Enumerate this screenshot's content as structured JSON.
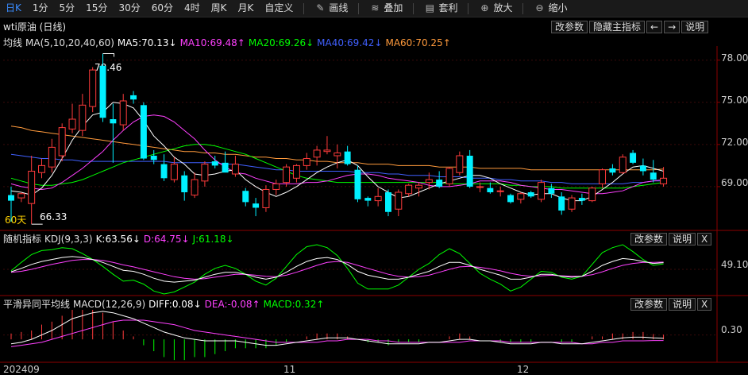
{
  "toolbar": {
    "periods": [
      "日K",
      "1分",
      "5分",
      "15分",
      "30分",
      "60分",
      "4时",
      "周K",
      "月K",
      "自定义"
    ],
    "active_period": "日K",
    "tools": [
      {
        "label": "画线",
        "icon": "pen-icon"
      },
      {
        "label": "叠加",
        "icon": "layers-icon"
      },
      {
        "label": "套利",
        "icon": "arbitrage-icon"
      },
      {
        "label": "放大",
        "icon": "zoom-in-icon"
      },
      {
        "label": "缩小",
        "icon": "zoom-out-icon"
      }
    ]
  },
  "main": {
    "title": "wti原油 (日线)",
    "buttons": [
      "改参数",
      "隐藏主指标",
      "←",
      "→",
      "说明"
    ],
    "ma_legend": {
      "name": "均线",
      "params": "MA(5,10,20,40,60)",
      "ma5": "MA5:70.13↓",
      "ma10": "MA10:69.48↑",
      "ma20": "MA20:69.26↓",
      "ma40": "MA40:69.42↓",
      "ma60": "MA60:70.25↑"
    },
    "high_label": "78.46",
    "low_label": "66.33",
    "period_label": "60天",
    "y_ticks": [
      "78.00",
      "75.00",
      "72.00",
      "69.00"
    ]
  },
  "kdj": {
    "name": "随机指标",
    "params": "KDJ(9,3,3)",
    "k": "K:63.56↓",
    "d": "D:64.75↓",
    "j": "J:61.18↓",
    "buttons": [
      "改参数",
      "说明",
      "X"
    ],
    "y_tick": "49.10"
  },
  "macd": {
    "name": "平滑异同平均线",
    "params": "MACD(12,26,9)",
    "diff": "DIFF:0.08↓",
    "dea": "DEA:-0.08↑",
    "macd": "MACD:0.32↑",
    "buttons": [
      "改参数",
      "说明",
      "X"
    ],
    "y_tick": "0.30"
  },
  "x_labels": [
    "202409",
    "11",
    "12"
  ],
  "colors": {
    "up": "#ff3b3b",
    "down": "#00f0ff",
    "ma5": "#ffffff",
    "ma10": "#ff40ff",
    "ma20": "#00ff00",
    "ma40": "#4060ff",
    "ma60": "#ff9a3c",
    "k": "#ffffff",
    "d": "#ff40ff",
    "j": "#00ff00"
  },
  "chart_data": {
    "type": "candlestick",
    "y_range": [
      66,
      79
    ],
    "candles": [
      {
        "o": 68.4,
        "h": 69.0,
        "l": 66.5,
        "c": 68.0
      },
      {
        "o": 68.2,
        "h": 68.6,
        "l": 67.9,
        "c": 68.5
      },
      {
        "o": 67.8,
        "h": 71.2,
        "l": 66.33,
        "c": 70.1
      },
      {
        "o": 70.0,
        "h": 71.0,
        "l": 69.6,
        "c": 70.5
      },
      {
        "o": 70.4,
        "h": 72.4,
        "l": 70.0,
        "c": 71.8
      },
      {
        "o": 71.2,
        "h": 73.5,
        "l": 70.8,
        "c": 73.2
      },
      {
        "o": 73.1,
        "h": 74.9,
        "l": 72.8,
        "c": 73.8
      },
      {
        "o": 73.0,
        "h": 75.6,
        "l": 72.6,
        "c": 74.8
      },
      {
        "o": 74.7,
        "h": 77.5,
        "l": 74.3,
        "c": 77.3
      },
      {
        "o": 77.6,
        "h": 78.46,
        "l": 73.6,
        "c": 73.9
      },
      {
        "o": 73.8,
        "h": 74.9,
        "l": 70.7,
        "c": 73.5
      },
      {
        "o": 73.4,
        "h": 75.6,
        "l": 73.0,
        "c": 75.1
      },
      {
        "o": 75.5,
        "h": 75.8,
        "l": 74.9,
        "c": 75.2
      },
      {
        "o": 74.8,
        "h": 75.0,
        "l": 70.9,
        "c": 71.0
      },
      {
        "o": 71.2,
        "h": 71.6,
        "l": 70.6,
        "c": 70.9
      },
      {
        "o": 70.6,
        "h": 71.3,
        "l": 69.4,
        "c": 69.6
      },
      {
        "o": 69.5,
        "h": 71.1,
        "l": 69.3,
        "c": 70.6
      },
      {
        "o": 69.8,
        "h": 70.1,
        "l": 68.0,
        "c": 68.6
      },
      {
        "o": 68.4,
        "h": 70.0,
        "l": 68.2,
        "c": 69.5
      },
      {
        "o": 69.4,
        "h": 70.8,
        "l": 69.0,
        "c": 70.6
      },
      {
        "o": 70.8,
        "h": 71.2,
        "l": 70.3,
        "c": 70.5
      },
      {
        "o": 70.7,
        "h": 71.5,
        "l": 70.2,
        "c": 70.0
      },
      {
        "o": 69.9,
        "h": 71.2,
        "l": 69.7,
        "c": 70.6
      },
      {
        "o": 68.7,
        "h": 68.9,
        "l": 67.6,
        "c": 67.9
      },
      {
        "o": 67.8,
        "h": 68.2,
        "l": 66.9,
        "c": 67.5
      },
      {
        "o": 67.5,
        "h": 69.1,
        "l": 67.2,
        "c": 68.8
      },
      {
        "o": 68.8,
        "h": 69.5,
        "l": 68.4,
        "c": 69.2
      },
      {
        "o": 69.3,
        "h": 70.6,
        "l": 69.0,
        "c": 70.4
      },
      {
        "o": 69.6,
        "h": 70.6,
        "l": 69.3,
        "c": 70.5
      },
      {
        "o": 70.5,
        "h": 71.4,
        "l": 70.2,
        "c": 71.0
      },
      {
        "o": 71.1,
        "h": 71.9,
        "l": 70.5,
        "c": 71.6
      },
      {
        "o": 71.5,
        "h": 72.6,
        "l": 71.3,
        "c": 71.6
      },
      {
        "o": 71.2,
        "h": 72.0,
        "l": 70.3,
        "c": 71.4
      },
      {
        "o": 71.5,
        "h": 71.9,
        "l": 70.5,
        "c": 70.6
      },
      {
        "o": 70.2,
        "h": 70.5,
        "l": 67.9,
        "c": 68.1
      },
      {
        "o": 68.2,
        "h": 68.3,
        "l": 67.6,
        "c": 68.0
      },
      {
        "o": 68.0,
        "h": 68.9,
        "l": 67.6,
        "c": 68.3
      },
      {
        "o": 68.6,
        "h": 68.8,
        "l": 66.9,
        "c": 67.2
      },
      {
        "o": 67.4,
        "h": 68.8,
        "l": 66.9,
        "c": 68.6
      },
      {
        "o": 68.5,
        "h": 69.2,
        "l": 68.3,
        "c": 69.1
      },
      {
        "o": 68.9,
        "h": 69.3,
        "l": 68.3,
        "c": 69.1
      },
      {
        "o": 69.3,
        "h": 70.0,
        "l": 68.8,
        "c": 69.5
      },
      {
        "o": 69.5,
        "h": 70.1,
        "l": 68.9,
        "c": 69.0
      },
      {
        "o": 69.2,
        "h": 70.4,
        "l": 69.0,
        "c": 70.3
      },
      {
        "o": 70.0,
        "h": 71.5,
        "l": 69.8,
        "c": 71.2
      },
      {
        "o": 71.2,
        "h": 71.6,
        "l": 68.9,
        "c": 69.0
      },
      {
        "o": 69.0,
        "h": 69.3,
        "l": 68.6,
        "c": 69.0
      },
      {
        "o": 68.9,
        "h": 69.3,
        "l": 68.5,
        "c": 68.6
      },
      {
        "o": 68.7,
        "h": 69.0,
        "l": 68.3,
        "c": 68.7
      },
      {
        "o": 68.4,
        "h": 68.5,
        "l": 67.8,
        "c": 67.9
      },
      {
        "o": 68.1,
        "h": 68.6,
        "l": 67.8,
        "c": 68.5
      },
      {
        "o": 68.6,
        "h": 68.7,
        "l": 68.2,
        "c": 68.3
      },
      {
        "o": 68.1,
        "h": 69.5,
        "l": 67.9,
        "c": 69.3
      },
      {
        "o": 68.9,
        "h": 69.2,
        "l": 68.2,
        "c": 68.5
      },
      {
        "o": 68.3,
        "h": 68.6,
        "l": 67.0,
        "c": 67.3
      },
      {
        "o": 67.4,
        "h": 68.4,
        "l": 67.2,
        "c": 68.2
      },
      {
        "o": 68.2,
        "h": 68.5,
        "l": 67.7,
        "c": 68.0
      },
      {
        "o": 68.0,
        "h": 69.0,
        "l": 67.9,
        "c": 68.9
      },
      {
        "o": 69.2,
        "h": 70.3,
        "l": 68.9,
        "c": 70.2
      },
      {
        "o": 70.3,
        "h": 70.6,
        "l": 69.8,
        "c": 70.0
      },
      {
        "o": 70.0,
        "h": 71.3,
        "l": 69.9,
        "c": 71.1
      },
      {
        "o": 71.4,
        "h": 71.6,
        "l": 70.6,
        "c": 70.7
      },
      {
        "o": 70.5,
        "h": 71.0,
        "l": 69.8,
        "c": 70.1
      },
      {
        "o": 70.0,
        "h": 70.9,
        "l": 69.3,
        "c": 69.5
      },
      {
        "o": 69.2,
        "h": 70.4,
        "l": 69.0,
        "c": 69.6
      }
    ],
    "ma5": [
      68.7,
      68.6,
      68.4,
      68.9,
      69.8,
      71.0,
      72.3,
      73.3,
      74.1,
      74.3,
      75.0,
      74.9,
      74.6,
      73.7,
      72.6,
      71.9,
      71.1,
      70.6,
      69.9,
      69.8,
      69.9,
      70.1,
      70.2,
      69.5,
      69.0,
      68.6,
      68.3,
      68.6,
      69.0,
      69.5,
      70.0,
      70.4,
      70.7,
      70.9,
      70.5,
      69.7,
      69.0,
      68.6,
      68.2,
      68.3,
      68.6,
      68.9,
      69.2,
      69.4,
      69.6,
      69.8,
      69.8,
      69.6,
      69.2,
      68.9,
      68.6,
      68.4,
      68.5,
      68.5,
      68.2,
      68.0,
      68.0,
      68.3,
      68.8,
      69.3,
      69.9,
      70.4,
      70.5,
      70.3,
      70.1
    ],
    "ma10": [
      69.2,
      69.0,
      68.9,
      68.8,
      68.9,
      69.3,
      69.8,
      70.3,
      70.9,
      71.5,
      72.3,
      73.0,
      73.6,
      74.0,
      74.1,
      74.0,
      73.6,
      73.0,
      72.4,
      71.6,
      70.9,
      70.4,
      70.0,
      69.9,
      69.6,
      69.4,
      69.2,
      69.2,
      69.2,
      69.3,
      69.3,
      69.4,
      69.6,
      69.8,
      69.9,
      69.9,
      69.8,
      69.6,
      69.5,
      69.4,
      69.3,
      69.1,
      69.0,
      69.0,
      69.1,
      69.2,
      69.4,
      69.4,
      69.4,
      69.3,
      69.1,
      69.0,
      68.9,
      68.8,
      68.8,
      68.7,
      68.6,
      68.5,
      68.5,
      68.6,
      68.7,
      69.0,
      69.3,
      69.4,
      69.5
    ],
    "ma20": [
      69.6,
      69.4,
      69.2,
      69.1,
      69.1,
      69.2,
      69.3,
      69.5,
      69.8,
      70.1,
      70.4,
      70.7,
      70.9,
      71.1,
      71.3,
      71.5,
      71.7,
      71.9,
      72.0,
      72.0,
      71.9,
      71.7,
      71.5,
      71.3,
      71.0,
      70.7,
      70.4,
      70.1,
      69.8,
      69.6,
      69.5,
      69.4,
      69.3,
      69.3,
      69.3,
      69.3,
      69.3,
      69.3,
      69.3,
      69.3,
      69.3,
      69.3,
      69.3,
      69.2,
      69.2,
      69.2,
      69.2,
      69.2,
      69.2,
      69.1,
      69.1,
      69.0,
      69.0,
      69.0,
      68.9,
      68.9,
      68.9,
      68.9,
      68.9,
      68.9,
      68.9,
      69.0,
      69.1,
      69.2,
      69.3
    ],
    "ma40": [
      71.3,
      71.2,
      71.1,
      71.0,
      71.0,
      70.9,
      70.9,
      70.8,
      70.8,
      70.8,
      70.8,
      70.8,
      70.8,
      70.8,
      70.8,
      70.8,
      70.7,
      70.7,
      70.7,
      70.7,
      70.7,
      70.6,
      70.6,
      70.5,
      70.4,
      70.3,
      70.2,
      70.2,
      70.1,
      70.1,
      70.1,
      70.1,
      70.1,
      70.1,
      70.0,
      70.0,
      70.0,
      69.9,
      69.9,
      69.8,
      69.8,
      69.8,
      69.7,
      69.7,
      69.7,
      69.6,
      69.6,
      69.6,
      69.5,
      69.5,
      69.4,
      69.4,
      69.4,
      69.3,
      69.3,
      69.2,
      69.2,
      69.2,
      69.2,
      69.2,
      69.2,
      69.3,
      69.3,
      69.4,
      69.4
    ],
    "ma60": [
      73.3,
      73.2,
      73.0,
      72.9,
      72.8,
      72.7,
      72.6,
      72.5,
      72.4,
      72.3,
      72.2,
      72.1,
      72.0,
      71.9,
      71.8,
      71.7,
      71.6,
      71.5,
      71.5,
      71.4,
      71.4,
      71.3,
      71.3,
      71.2,
      71.1,
      71.1,
      71.0,
      71.0,
      70.9,
      70.9,
      70.8,
      70.8,
      70.7,
      70.7,
      70.7,
      70.6,
      70.6,
      70.6,
      70.5,
      70.5,
      70.5,
      70.5,
      70.4,
      70.4,
      70.4,
      70.4,
      70.3,
      70.3,
      70.3,
      70.3,
      70.3,
      70.2,
      70.2,
      70.2,
      70.2,
      70.2,
      70.2,
      70.2,
      70.2,
      70.2,
      70.2,
      70.2,
      70.2,
      70.2,
      70.25
    ],
    "kdj_range": [
      0,
      100
    ],
    "k": [
      45,
      52,
      60,
      66,
      70,
      74,
      76,
      74,
      70,
      64,
      56,
      48,
      46,
      40,
      32,
      26,
      24,
      26,
      28,
      34,
      40,
      44,
      44,
      40,
      34,
      30,
      34,
      44,
      56,
      66,
      72,
      74,
      70,
      60,
      46,
      38,
      34,
      30,
      30,
      34,
      40,
      46,
      56,
      64,
      64,
      58,
      50,
      44,
      38,
      30,
      30,
      34,
      40,
      40,
      36,
      34,
      36,
      46,
      58,
      66,
      72,
      70,
      66,
      62,
      63.56
    ],
    "d": [
      44,
      46,
      50,
      55,
      60,
      64,
      68,
      70,
      70,
      68,
      64,
      59,
      55,
      50,
      45,
      40,
      35,
      32,
      30,
      31,
      34,
      37,
      40,
      40,
      38,
      36,
      35,
      38,
      44,
      51,
      58,
      64,
      66,
      64,
      58,
      52,
      46,
      40,
      36,
      34,
      35,
      38,
      44,
      50,
      55,
      56,
      54,
      51,
      47,
      42,
      38,
      36,
      37,
      38,
      37,
      36,
      36,
      39,
      45,
      52,
      58,
      62,
      64,
      64,
      64.75
    ],
    "j": [
      47,
      64,
      80,
      88,
      90,
      94,
      92,
      82,
      70,
      56,
      40,
      26,
      28,
      20,
      6,
      0,
      4,
      14,
      24,
      40,
      52,
      58,
      52,
      40,
      26,
      18,
      32,
      56,
      80,
      96,
      100,
      94,
      78,
      52,
      22,
      10,
      10,
      10,
      18,
      34,
      50,
      62,
      80,
      92,
      82,
      62,
      42,
      30,
      20,
      6,
      14,
      30,
      46,
      44,
      34,
      30,
      36,
      60,
      84,
      94,
      100,
      86,
      70,
      58,
      61.18
    ],
    "macd_range": [
      -1.5,
      2.0
    ],
    "diff": [
      -0.3,
      -0.2,
      0.0,
      0.3,
      0.6,
      1.0,
      1.4,
      1.6,
      1.8,
      1.9,
      1.8,
      1.6,
      1.4,
      1.1,
      0.8,
      0.5,
      0.3,
      0.1,
      0.0,
      -0.1,
      -0.1,
      -0.1,
      -0.1,
      -0.2,
      -0.3,
      -0.4,
      -0.4,
      -0.3,
      -0.2,
      -0.1,
      0.0,
      0.1,
      0.1,
      0.1,
      0.0,
      -0.1,
      -0.2,
      -0.3,
      -0.3,
      -0.3,
      -0.3,
      -0.2,
      -0.2,
      -0.1,
      0.0,
      0.0,
      -0.1,
      -0.1,
      -0.2,
      -0.3,
      -0.3,
      -0.3,
      -0.2,
      -0.2,
      -0.3,
      -0.3,
      -0.3,
      -0.2,
      -0.1,
      0.0,
      0.1,
      0.15,
      0.15,
      0.1,
      0.08
    ],
    "dea": [
      -0.5,
      -0.4,
      -0.3,
      -0.2,
      0.0,
      0.2,
      0.4,
      0.6,
      0.8,
      1.0,
      1.2,
      1.3,
      1.3,
      1.3,
      1.2,
      1.1,
      1.0,
      0.8,
      0.6,
      0.5,
      0.4,
      0.3,
      0.2,
      0.1,
      0.0,
      -0.1,
      -0.2,
      -0.2,
      -0.2,
      -0.2,
      -0.2,
      -0.1,
      -0.1,
      0.0,
      0.0,
      0.0,
      -0.1,
      -0.1,
      -0.2,
      -0.2,
      -0.2,
      -0.2,
      -0.2,
      -0.2,
      -0.2,
      -0.1,
      -0.1,
      -0.1,
      -0.1,
      -0.2,
      -0.2,
      -0.2,
      -0.2,
      -0.2,
      -0.2,
      -0.2,
      -0.3,
      -0.3,
      -0.2,
      -0.2,
      -0.1,
      -0.1,
      -0.1,
      -0.08,
      -0.08
    ],
    "macd_bars": [
      0.4,
      0.5,
      0.6,
      1.0,
      1.2,
      1.6,
      2.0,
      2.0,
      2.0,
      1.8,
      1.2,
      0.6,
      0.2,
      -0.4,
      -0.8,
      -1.2,
      -1.4,
      -1.4,
      -1.2,
      -1.2,
      -1.0,
      -0.8,
      -0.6,
      -0.6,
      -0.6,
      -0.6,
      -0.4,
      -0.2,
      0.0,
      0.2,
      0.4,
      0.4,
      0.4,
      0.2,
      0.0,
      -0.2,
      -0.2,
      -0.4,
      -0.2,
      -0.2,
      -0.2,
      0.0,
      0.0,
      0.2,
      0.4,
      0.2,
      0.0,
      0.0,
      -0.2,
      -0.2,
      -0.2,
      -0.2,
      0.0,
      0.0,
      -0.2,
      -0.2,
      0.0,
      0.2,
      0.2,
      0.4,
      0.4,
      0.5,
      0.5,
      0.36,
      0.32
    ]
  }
}
